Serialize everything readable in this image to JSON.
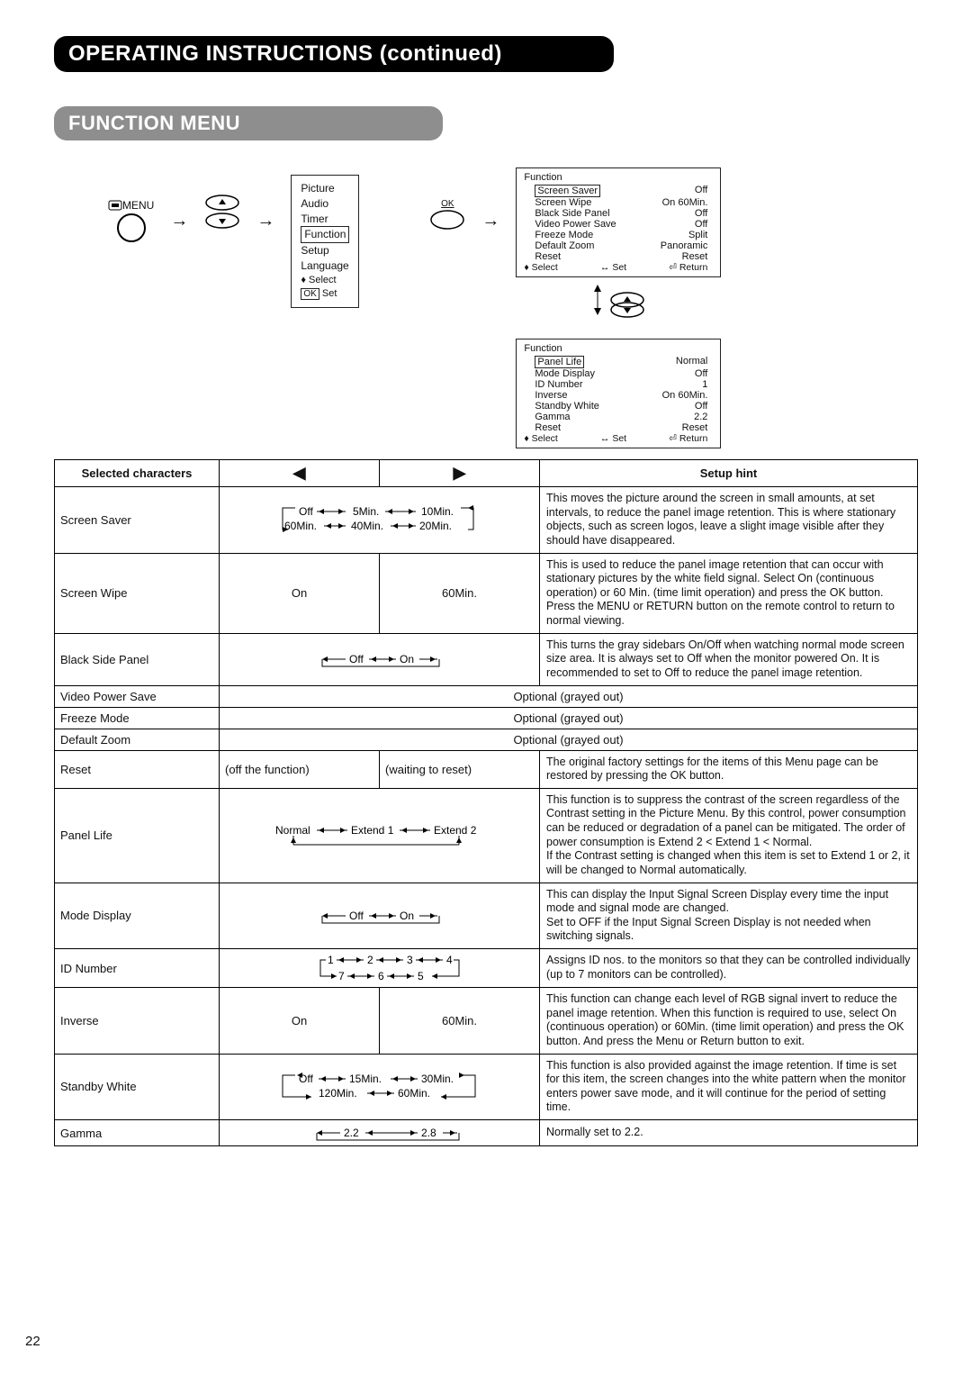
{
  "page_number": "22",
  "header": {
    "title": "OPERATING INSTRUCTIONS (continued)"
  },
  "section": {
    "title": "FUNCTION MENU"
  },
  "flow": {
    "menu_label": "MENU",
    "ok_label": "OK",
    "menu_items": {
      "i0": "Picture",
      "i1": "Audio",
      "i2": "Timer",
      "i3": "Function",
      "i4": "Setup",
      "i5": "Language",
      "foot_select": "Select",
      "foot_set": "Set",
      "foot_set_prefix": "OK"
    },
    "osd1": {
      "title": "Function",
      "rows": {
        "r0": {
          "l": "Screen Saver",
          "r": "Off"
        },
        "r1": {
          "l": "Screen Wipe",
          "r": "On  60Min."
        },
        "r2": {
          "l": "Black Side Panel",
          "r": "Off"
        },
        "r3": {
          "l": "Video Power Save",
          "r": "Off"
        },
        "r4": {
          "l": "Freeze Mode",
          "r": "Split"
        },
        "r5": {
          "l": "Default Zoom",
          "r": "Panoramic"
        },
        "r6": {
          "l": "Reset",
          "r": "Reset"
        }
      },
      "foot": {
        "select": "Select",
        "set": "Set",
        "ret": "Return"
      }
    },
    "osd2": {
      "title": "Function",
      "rows": {
        "r0": {
          "l": "Panel Life",
          "r": "Normal"
        },
        "r1": {
          "l": "Mode Display",
          "r": "Off"
        },
        "r2": {
          "l": "ID Number",
          "r": "1"
        },
        "r3": {
          "l": "Inverse",
          "r": "On  60Min."
        },
        "r4": {
          "l": "Standby White",
          "r": "Off"
        },
        "r5": {
          "l": "Gamma",
          "r": "2.2"
        },
        "r6": {
          "l": "Reset",
          "r": "Reset"
        }
      },
      "foot": {
        "select": "Select",
        "set": "Set",
        "ret": "Return"
      }
    }
  },
  "table": {
    "head": {
      "c0": "Selected characters",
      "c1l": "◀",
      "c1r": "▶",
      "c3": "Setup hint"
    },
    "rows": {
      "screensaver": {
        "name": "Screen Saver",
        "opts": "Off ↔ 5Min. ↔ 10Min. | 60Min. ↔ 40Min. ↔ 20Min.",
        "hint": "This moves the picture around the screen in small amounts, at set intervals, to reduce the panel image retention. This is where stationary objects, such as screen logos, leave a slight image visible after they should have disappeared."
      },
      "screenwipe": {
        "name": "Screen Wipe",
        "left": "On",
        "right": "60Min.",
        "hint": "This is used to reduce the panel image retention that can occur with stationary pictures by the white field signal. Select On (continuous operation) or 60 Min. (time limit operation) and press the OK button. Press the MENU or RETURN button on the remote control to return to normal viewing."
      },
      "blackside": {
        "name": "Black Side Panel",
        "opts": "Off ↔ On",
        "hint": "This turns the gray sidebars On/Off when watching normal mode screen size area. It is always set to Off when the monitor powered On. It is recommended to set to Off to reduce the panel image retention."
      },
      "videopower": {
        "name": "Video Power Save",
        "opt": "Optional (grayed out)"
      },
      "freeze": {
        "name": "Freeze Mode",
        "opt": "Optional (grayed out)"
      },
      "defzoom": {
        "name": "Default Zoom",
        "opt": "Optional (grayed out)"
      },
      "reset": {
        "name": "Reset",
        "left": "(off the function)",
        "right": "(waiting to reset)",
        "hint": "The original factory settings for the items of this Menu page can be restored by pressing the OK button."
      },
      "panellife": {
        "name": "Panel Life",
        "opts": "Normal ↔ Extend 1 ↔ Extend 2",
        "hint": "This function is to suppress the contrast of the screen regardless of the Contrast setting in the Picture Menu. By this control, power consumption can be reduced or degradation of a panel can be mitigated. The order of power consumption is Extend 2 < Extend 1 < Normal.\nIf the Contrast setting is changed when this item is set to Extend 1 or 2, it will be changed to Normal automatically."
      },
      "modedisplay": {
        "name": "Mode Display",
        "opts": "Off ↔ On",
        "hint": "This can display the Input Signal Screen Display every time the input mode and signal mode are changed.\nSet to OFF if the Input Signal Screen Display is not needed when switching signals."
      },
      "idnumber": {
        "name": "ID Number",
        "opts": "1 ↔ 2 ↔ 3 ↔ 4 | 7 ↔ 6 ↔ 5",
        "hint": "Assigns ID nos. to the monitors so that they can be controlled individually (up to 7 monitors can be controlled)."
      },
      "inverse": {
        "name": "Inverse",
        "left": "On",
        "right": "60Min.",
        "hint": "This function can change each level of RGB signal invert to reduce the panel image retention. When this function is required to use, select On (continuous operation) or 60Min. (time limit operation) and press the OK button. And press the Menu or Return button to exit."
      },
      "stbywhite": {
        "name": "Standby White",
        "opts": "Off ↔ 15Min. ↔ 30Min. | 120Min. ↔ 60Min.",
        "hint": "This function is also provided against the image retention. If time is set for this item, the screen changes into the white pattern when the monitor enters power save mode, and it will continue for the period of setting time."
      },
      "gamma": {
        "name": "Gamma",
        "opts": "2.2 ↔ 2.8",
        "hint": "Normally set to 2.2."
      }
    }
  }
}
